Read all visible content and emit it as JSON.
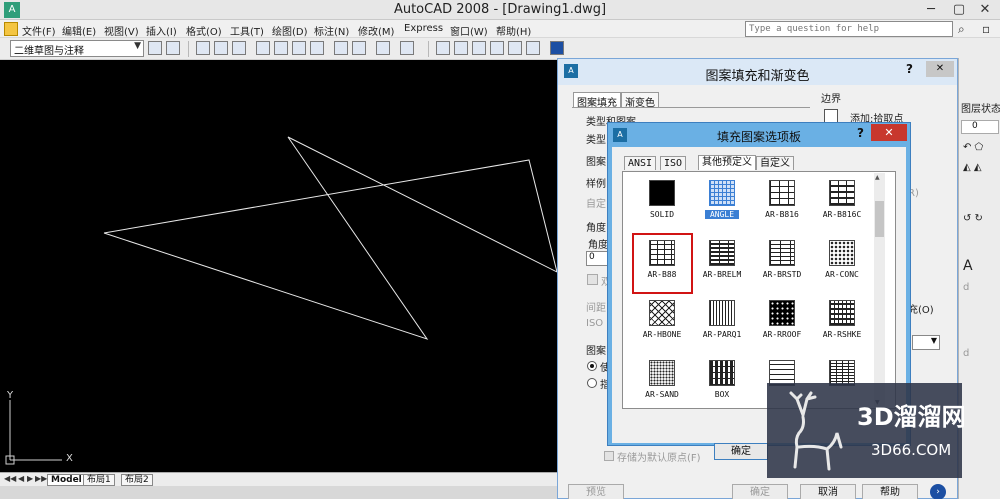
{
  "window": {
    "title": "AutoCAD 2008 - [Drawing1.dwg]",
    "app_icon": "A"
  },
  "menu": {
    "items": [
      "文件(F)",
      "编辑(E)",
      "视图(V)",
      "插入(I)",
      "格式(O)",
      "工具(T)",
      "绘图(D)",
      "标注(N)",
      "修改(M)",
      "Express",
      "窗口(W)",
      "帮助(H)"
    ],
    "help_placeholder": "Type a question for help"
  },
  "toolbar": {
    "workspace": "二维草图与注释"
  },
  "layout_tabs": [
    "Model",
    "布局1",
    "布局2"
  ],
  "ucs": {
    "x_label": "X",
    "y_label": "Y"
  },
  "main_dialog": {
    "title": "图案填充和渐变色",
    "help": "?",
    "close": "✕",
    "tabs": [
      "图案填充",
      "渐变色"
    ],
    "labels": {
      "type_and_pattern": "类型和图案",
      "type": "类型",
      "pattern": "图案",
      "swatch": "样例",
      "custom": "自定",
      "angle_scale": "角度",
      "angle": "角度",
      "angle_value": "0",
      "double": "双",
      "spacing": "间距",
      "iso": "ISO",
      "origin": "图案",
      "use_current": "使",
      "specify": "指",
      "store_default": "存储为默认原点(F)",
      "boundaries": "边界",
      "add_pick": "添加:拾取点",
      "fill_partial": "充(O)",
      "r_label": "R)"
    },
    "buttons": {
      "preview": "预览",
      "ok": "确定",
      "cancel": "取消",
      "help": "帮助"
    }
  },
  "sub_dialog": {
    "title": "填充图案选项板",
    "help": "?",
    "close": "✕",
    "tabs": [
      "ANSI",
      "ISO",
      "其他预定义",
      "自定义"
    ],
    "patterns": [
      "SOLID",
      "ANGLE",
      "AR-B816",
      "AR-B816C",
      "AR-B88",
      "AR-BRELM",
      "AR-BRSTD",
      "AR-CONC",
      "AR-HBONE",
      "AR-PARQ1",
      "AR-RROOF",
      "AR-RSHKE",
      "AR-SAND",
      "BOX",
      "",
      ""
    ],
    "selected_pattern": "ANGLE",
    "highlighted_pattern": "AR-B88",
    "ok": "确定"
  },
  "right_panel": {
    "layer_state": "图层状态",
    "zero": "0",
    "a_label": "A",
    "d1": "d",
    "d2": "d"
  },
  "watermark": {
    "text": "3D溜溜网",
    "sub": "3D66.COM"
  },
  "colors": {
    "accent": "#3b7fd4",
    "highlight_box": "#d11414",
    "close_red": "#c8372d",
    "canvas": "#000000"
  }
}
